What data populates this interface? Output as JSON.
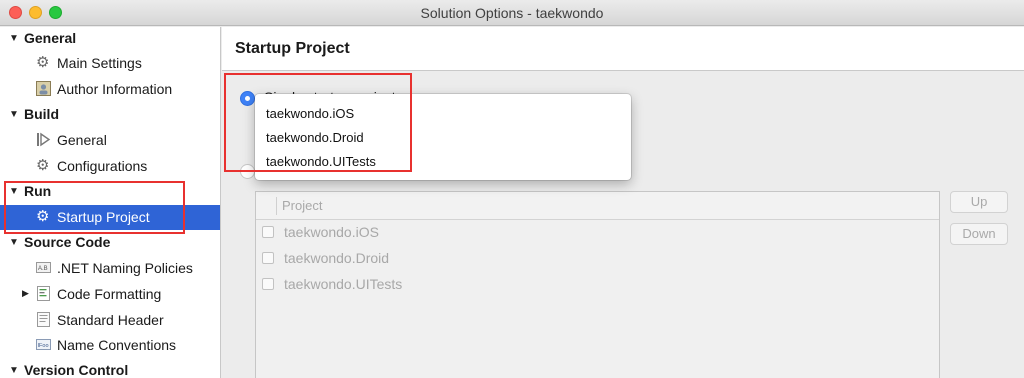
{
  "window": {
    "title": "Solution Options - taekwondo"
  },
  "sidebar": {
    "sections": [
      {
        "label": "General",
        "items": [
          {
            "label": "Main Settings",
            "icon": "gear-icon"
          },
          {
            "label": "Author Information",
            "icon": "author-card-icon"
          }
        ]
      },
      {
        "label": "Build",
        "items": [
          {
            "label": "General",
            "icon": "build-arrow-icon"
          },
          {
            "label": "Configurations",
            "icon": "gear-icon"
          }
        ]
      },
      {
        "label": "Run",
        "items": [
          {
            "label": "Startup Project",
            "icon": "gear-icon",
            "selected": true
          }
        ]
      },
      {
        "label": "Source Code",
        "items": [
          {
            "label": ".NET Naming Policies",
            "icon": "ab-icon"
          },
          {
            "label": "Code Formatting",
            "icon": "code-file-icon",
            "expandable": true
          },
          {
            "label": "Standard Header",
            "icon": "document-icon"
          },
          {
            "label": "Name Conventions",
            "icon": "ifoo-icon"
          }
        ]
      },
      {
        "label": "Version Control",
        "items": []
      }
    ]
  },
  "main": {
    "title": "Startup Project",
    "single_label": "Single startup project:",
    "dropdown_options": [
      "taekwondo.iOS",
      "taekwondo.Droid",
      "taekwondo.UITests"
    ],
    "table": {
      "header": "Project",
      "rows": [
        "taekwondo.iOS",
        "taekwondo.Droid",
        "taekwondo.UITests"
      ]
    },
    "buttons": {
      "up": "Up",
      "down": "Down"
    }
  },
  "colors": {
    "selection": "#2f64d6",
    "highlight_box": "#e8312f",
    "radio_accent": "#3e82f7"
  }
}
